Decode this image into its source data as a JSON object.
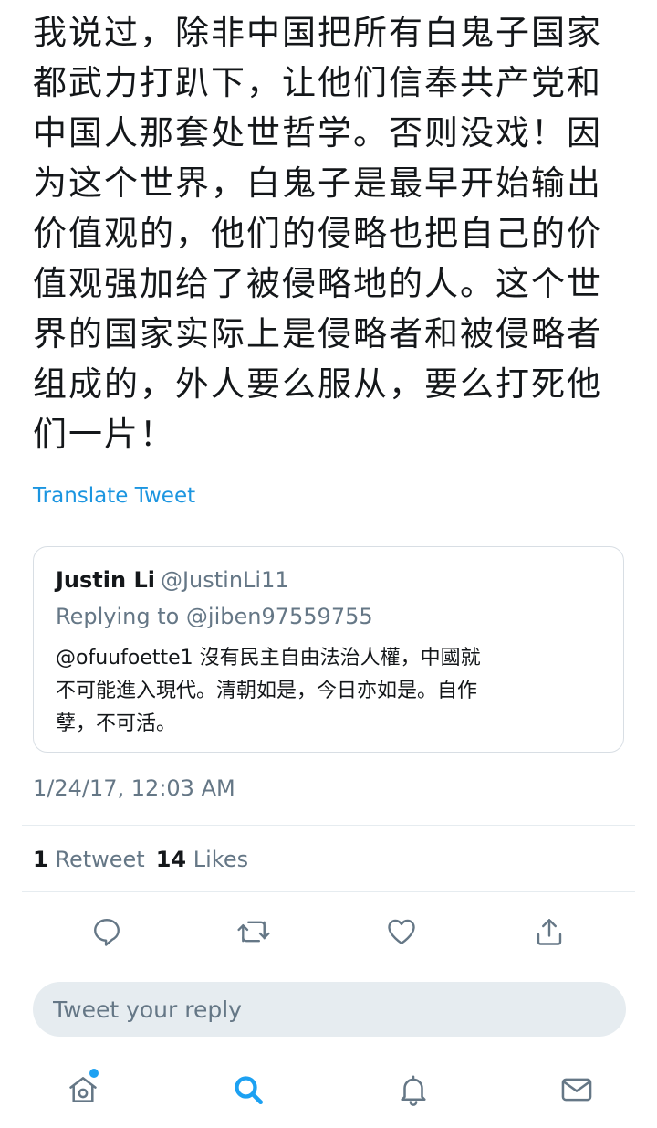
{
  "tweet": {
    "text": "我说过，除非中国把所有白鬼子国家\n都武力打趴下，让他们信奉共产党和\n中国人那套处世哲学。否则没戏！因\n为这个世界，白鬼子是最早开始输出\n价值观的，他们的侵略也把自己的价\n值观强加给了被侵略地的人。这个世\n界的国家实际上是侵略者和被侵略者\n组成的，外人要么服从，要么打死他\n们一片！",
    "translate_label": "Translate Tweet",
    "timestamp": "1/24/17, 12:03 AM"
  },
  "quoted_tweet": {
    "name": "Justin Li",
    "handle": "@JustinLi11",
    "replying_to": "Replying to @jiben97559755",
    "text": "@ofuufoette1 沒有民主自由法治人權，中國就\n不可能進入現代。清朝如是，今日亦如是。自作\n孽，不可活。"
  },
  "stats": {
    "retweets_count": "1",
    "retweets_label": "Retweet",
    "likes_count": "14",
    "likes_label": "Likes"
  },
  "actions": [
    "reply-icon",
    "retweet-icon",
    "like-icon",
    "share-icon"
  ],
  "reply_box": {
    "placeholder": "Tweet your reply"
  },
  "tab_bar": {
    "tabs": [
      "home-icon",
      "search-icon",
      "notifications-icon",
      "messages-icon"
    ],
    "active": "search-icon",
    "home_has_notification": true
  },
  "colors": {
    "accent": "#1da1f2",
    "link": "#1b95e0",
    "icon_gray": "#657786",
    "text": "#14171a"
  }
}
